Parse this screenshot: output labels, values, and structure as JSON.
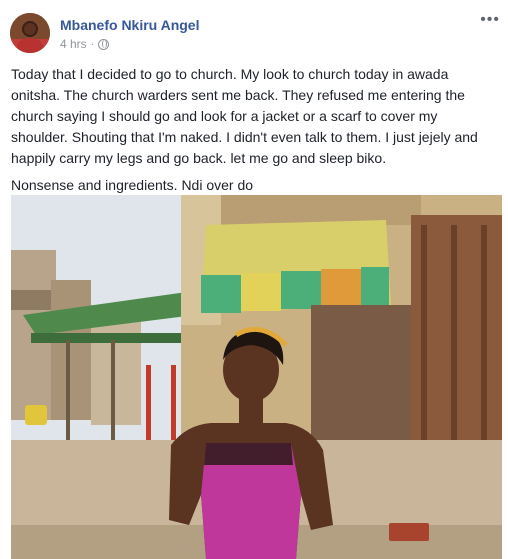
{
  "post": {
    "author": "Mbanefo Nkiru Angel",
    "timestamp": "4 hrs",
    "separator": "·",
    "privacy_icon": "globe-icon",
    "more_icon": "ellipsis-icon",
    "more_label": "•••",
    "paragraphs": [
      "Today that I decided to go to church. My look to church today in awada onitsha. The church warders sent me back. They refused me entering the church saying I should go and look for a jacket or a scarf to cover my shoulder. Shouting that I'm naked. I didn't even talk to them. I just jejely and happily carry my legs and go back. let me go and sleep biko.",
      "Nonsense and ingredients. Ndi over do"
    ]
  },
  "colors": {
    "author_link": "#365899",
    "meta_gray": "#90949c",
    "text": "#1d2129",
    "dress": "#c0379b"
  }
}
